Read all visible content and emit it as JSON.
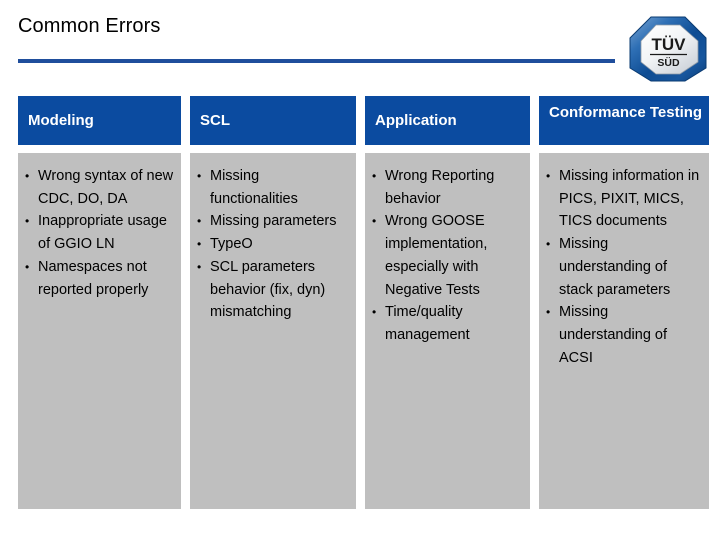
{
  "slide": {
    "title": "Common Errors",
    "accent_color": "#1F4E9C",
    "header_bg_color": "#0B4BA0",
    "cell_bg_color": "#BFBFBF",
    "header_text_color": "#FFFFFF",
    "body_text_color": "#000000"
  },
  "logo": {
    "name": "tuv-sud-logo",
    "primary_text": "TÜV",
    "secondary_text": "SÜD"
  },
  "table": {
    "columns": [
      {
        "header": "Modeling",
        "items": [
          "Wrong syntax of new CDC, DO, DA",
          "Inappropriate usage of GGIO LN",
          "Namespaces not reported properly"
        ]
      },
      {
        "header": "SCL",
        "items": [
          "Missing functionalities",
          "Missing parameters",
          "TypeO",
          "SCL parameters behavior (fix, dyn) mismatching"
        ]
      },
      {
        "header": "Application",
        "items": [
          "Wrong Reporting behavior",
          "Wrong GOOSE implementation, especially with Negative Tests",
          "Time/quality management"
        ]
      },
      {
        "header": "Conformance Testing",
        "items": [
          "Missing information in PICS, PIXIT, MICS, TICS documents",
          "Missing understanding of stack parameters",
          "Missing understanding of ACSI"
        ]
      }
    ]
  }
}
